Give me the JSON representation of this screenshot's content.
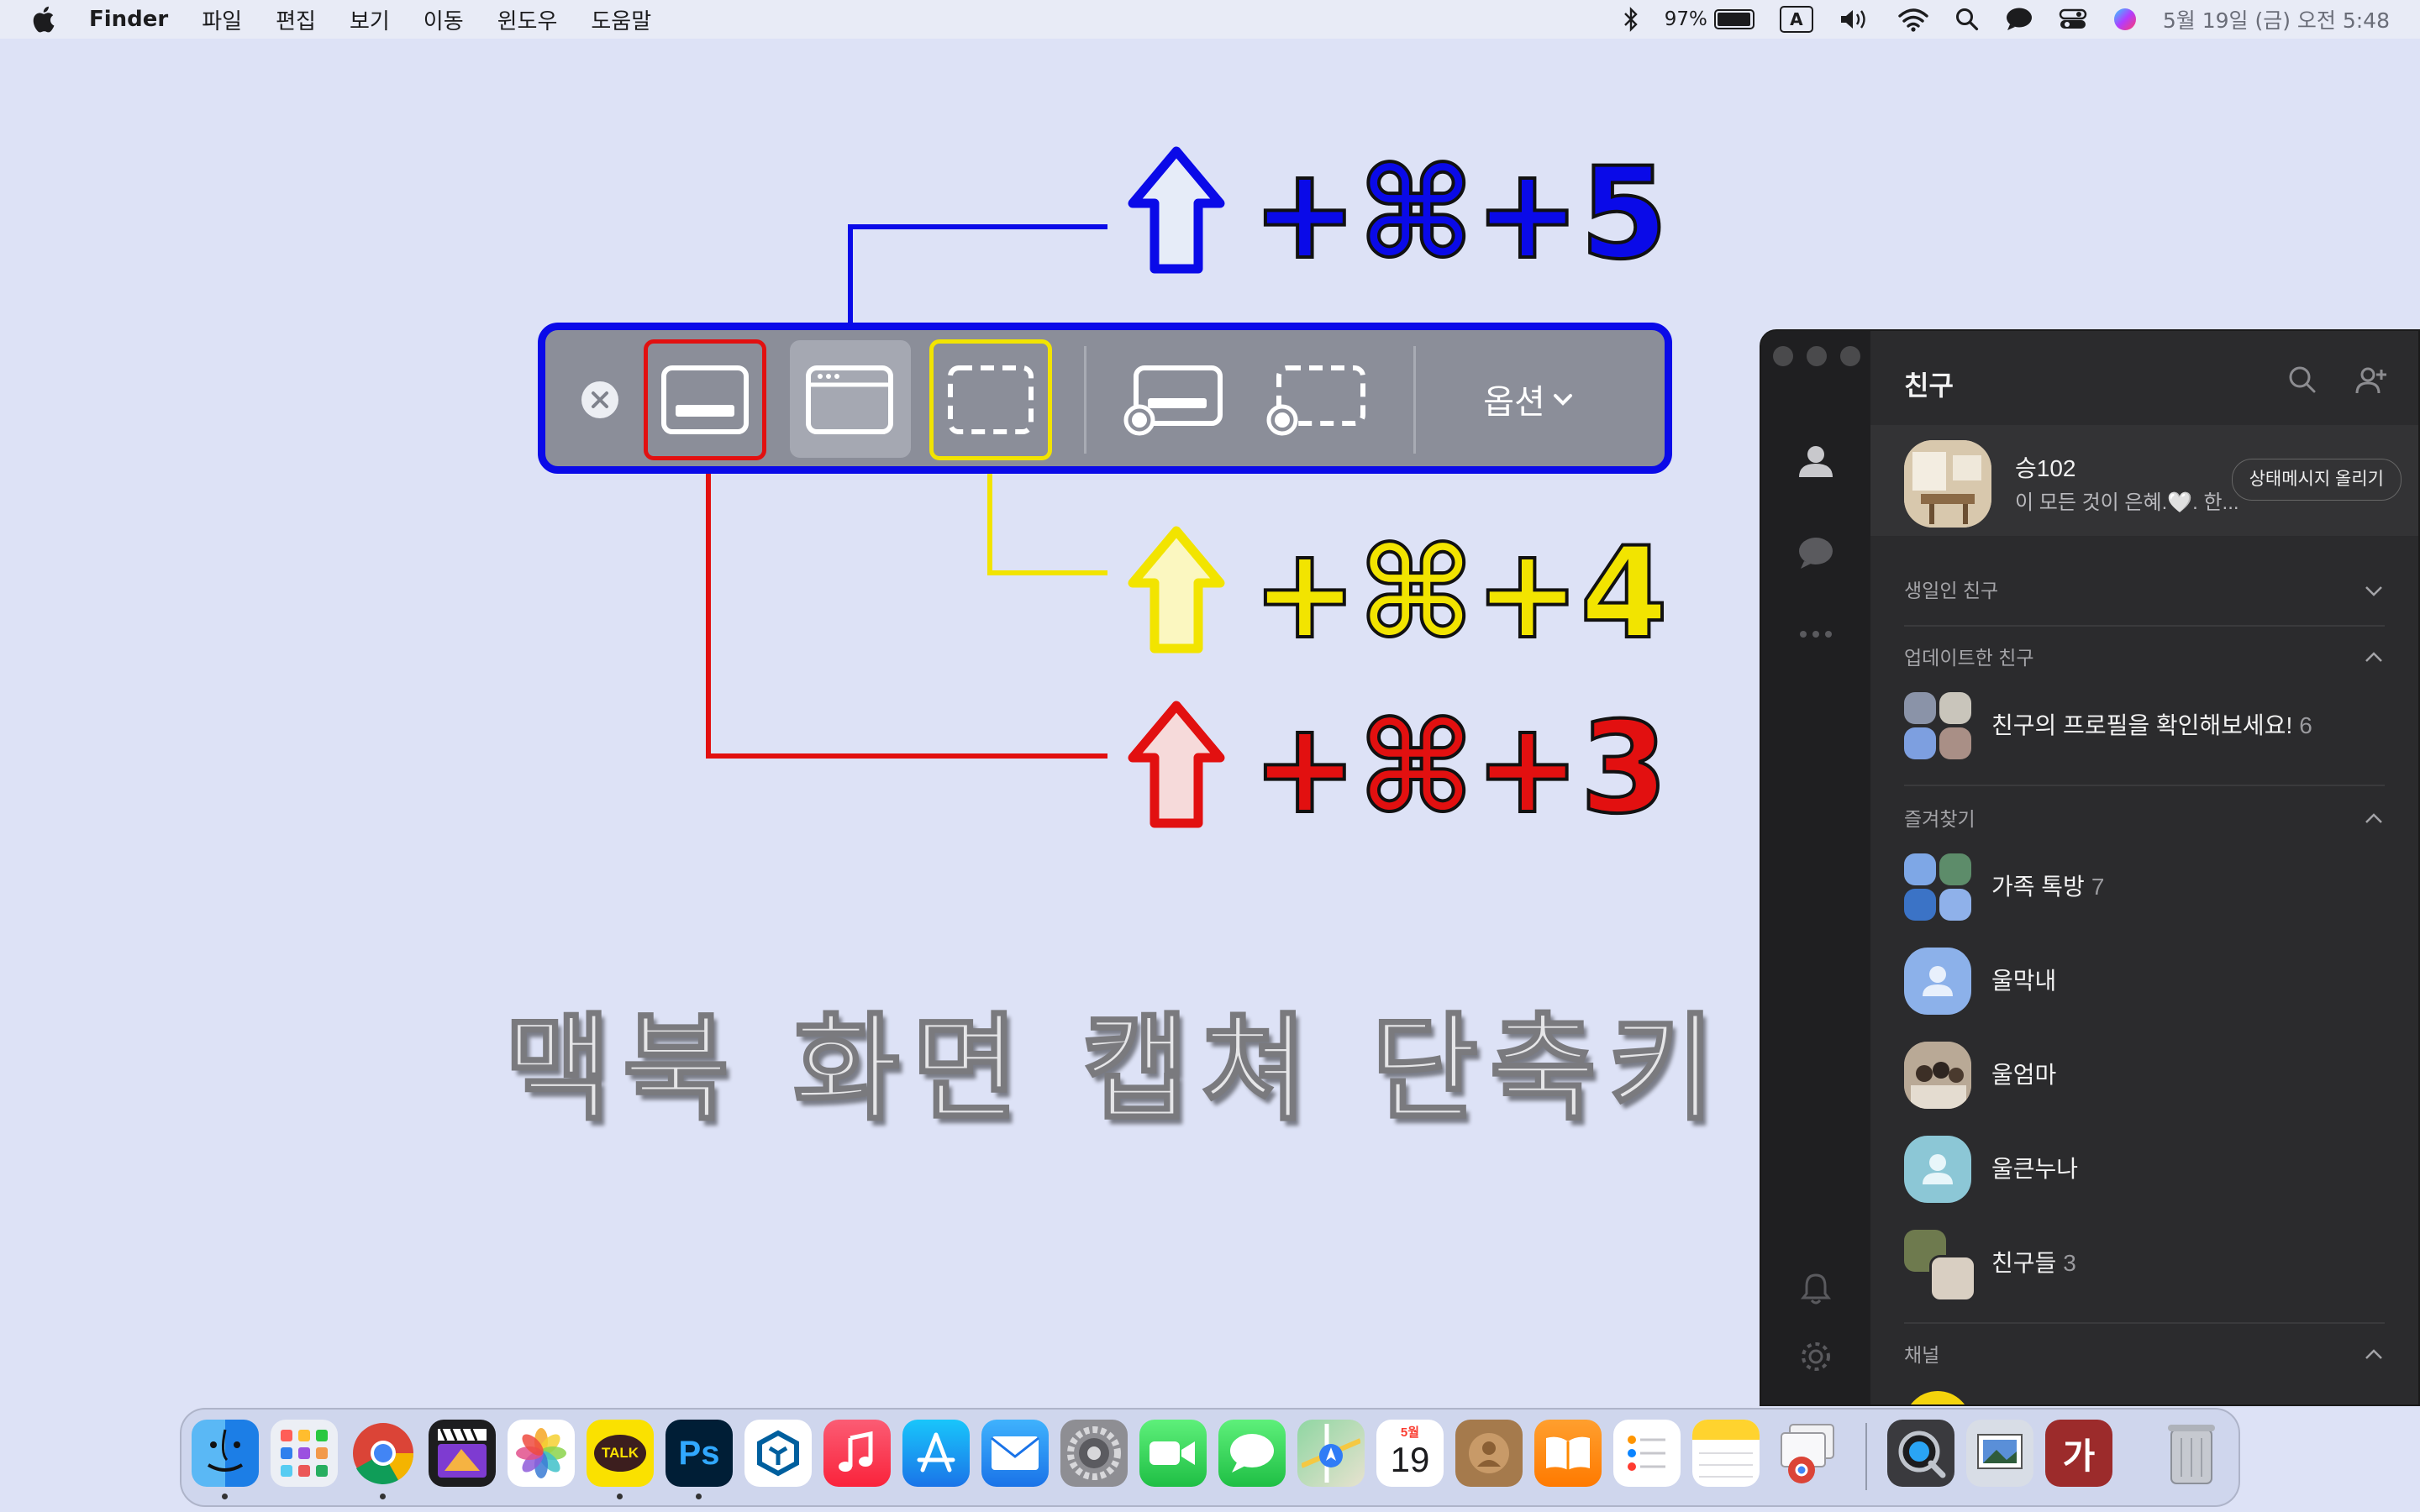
{
  "menubar": {
    "app_name": "Finder",
    "menus": [
      "파일",
      "편집",
      "보기",
      "이동",
      "윈도우",
      "도움말"
    ],
    "battery_percent": "97%",
    "battery_level": 0.97,
    "input_source": "A",
    "datetime": "5월 19일 (금) 오전 5:48"
  },
  "toolbar": {
    "options_label": "옵션"
  },
  "shortcuts": [
    {
      "text": "+⌘+5",
      "color": "#0a0ae8"
    },
    {
      "text": "+⌘+4",
      "color": "#f2e400"
    },
    {
      "text": "+⌘+3",
      "color": "#e21010"
    }
  ],
  "headline": "맥북 화면 캡쳐 단축키",
  "kakao": {
    "title": "친구",
    "my_profile": {
      "name": "승102",
      "status": "이 모든 것이 은혜.🤍. 한...",
      "status_button": "상태메시지 올리기"
    },
    "sections": {
      "birthday": "생일인 친구",
      "updated": "업데이트한 친구",
      "favorites": "즐겨찾기",
      "channel": "채널"
    },
    "updated_row": {
      "label": "친구의 프로필을 확인해보세요!",
      "count": "6"
    },
    "favorites": [
      {
        "name": "가족 톡방",
        "count": "7"
      },
      {
        "name": "울막내",
        "count": ""
      },
      {
        "name": "울엄마",
        "count": ""
      },
      {
        "name": "울큰누나",
        "count": ""
      },
      {
        "name": "친구들",
        "count": "3"
      }
    ]
  },
  "dock": {
    "calendar_month": "5월",
    "calendar_day": "19",
    "kakao_label": "TALK",
    "ps_label": "Ps",
    "dict_label": "가"
  }
}
